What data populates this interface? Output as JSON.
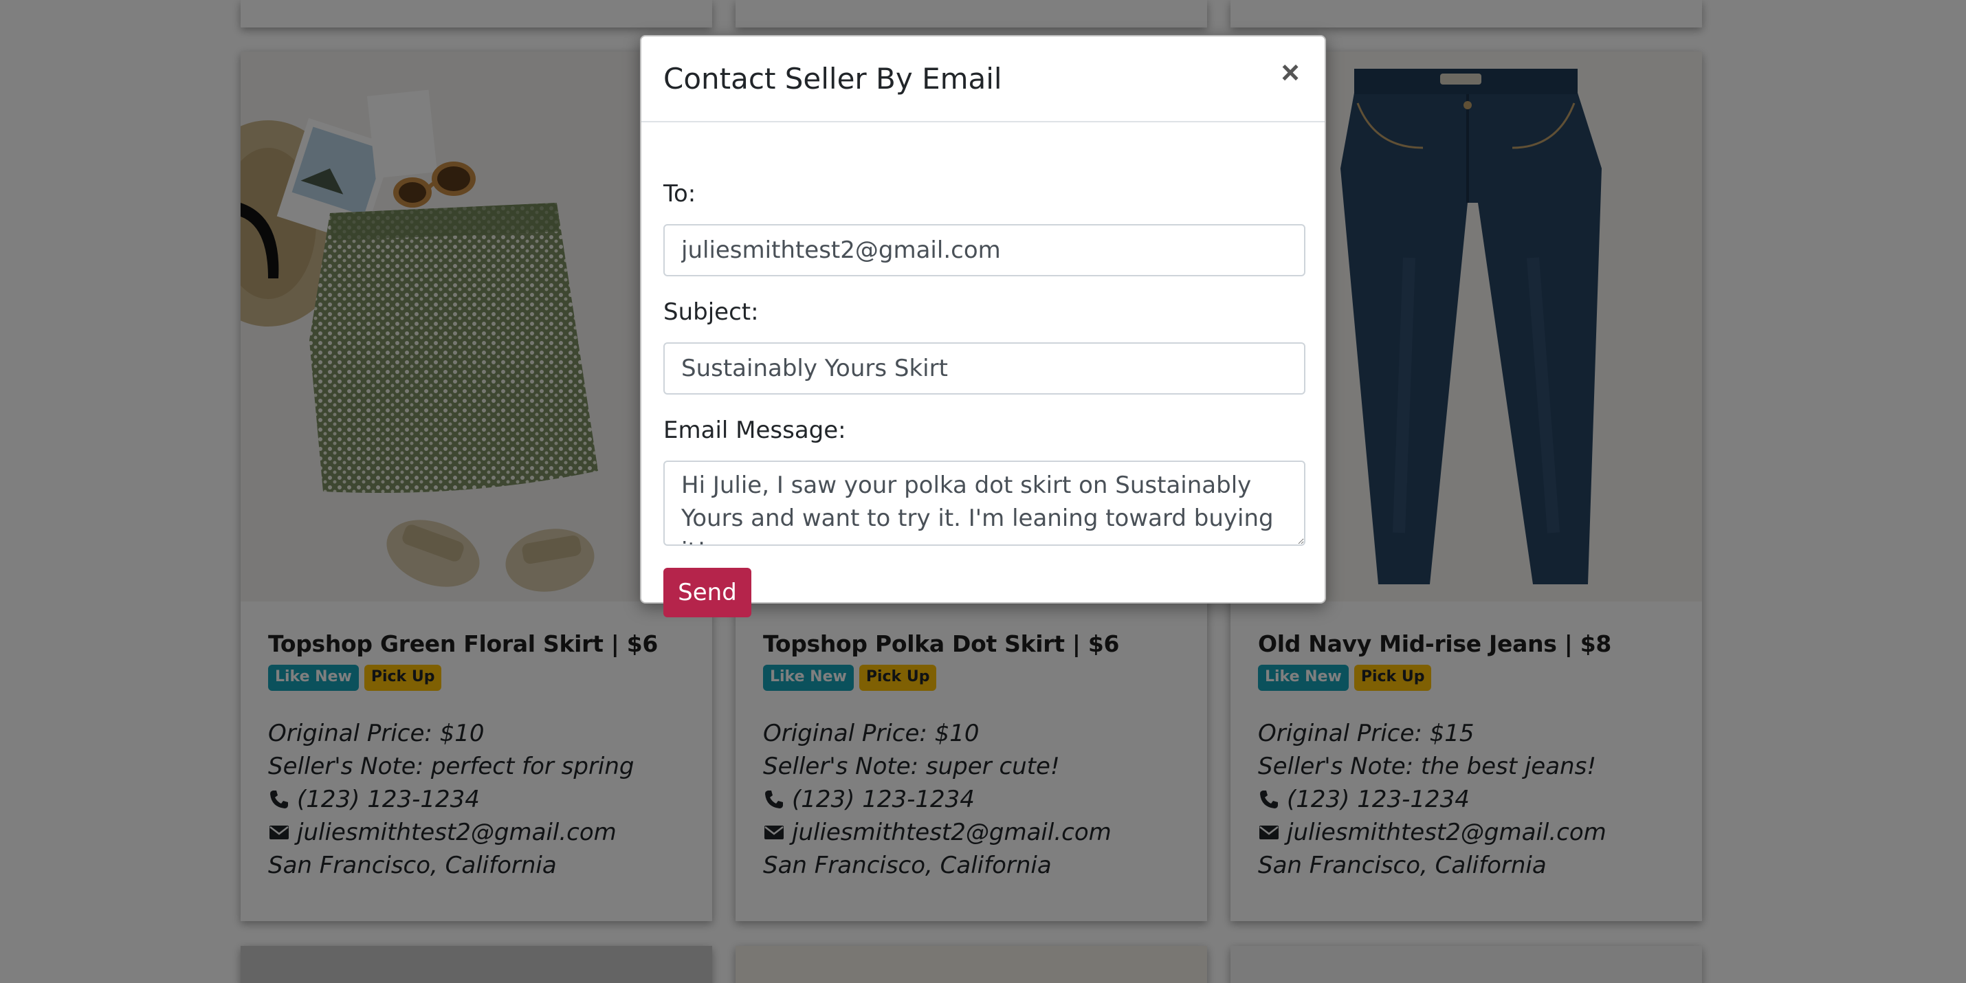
{
  "modal": {
    "title": "Contact Seller By Email",
    "close_label": "×",
    "to_label": "To:",
    "to_value": "juliesmithtest2@gmail.com",
    "subject_label": "Subject:",
    "subject_value": "Sustainably Yours Skirt",
    "message_label": "Email Message:",
    "message_value": "Hi Julie, I saw your polka dot skirt on Sustainably Yours and want to try it. I'm leaning toward buying it!",
    "send_label": "Send"
  },
  "listings": [
    {
      "title": "Topshop Green Floral Skirt | $6",
      "condition": "Like New",
      "shipping": "Pick Up",
      "original_price": "Original Price: $10",
      "note": "Seller's Note: perfect for spring",
      "phone": "(123) 123-1234",
      "email": "juliesmithtest2@gmail.com",
      "location": "San Francisco, California"
    },
    {
      "title": "Topshop Polka Dot Skirt | $6",
      "condition": "Like New",
      "shipping": "Pick Up",
      "original_price": "Original Price: $10",
      "note": "Seller's Note: super cute!",
      "phone": "(123) 123-1234",
      "email": "juliesmithtest2@gmail.com",
      "location": "San Francisco, California"
    },
    {
      "title": "Old Navy Mid-rise Jeans | $8",
      "condition": "Like New",
      "shipping": "Pick Up",
      "original_price": "Original Price: $15",
      "note": "Seller's Note: the best jeans!",
      "phone": "(123) 123-1234",
      "email": "juliesmithtest2@gmail.com",
      "location": "San Francisco, California"
    }
  ],
  "colors": {
    "send_button": "#b5244b",
    "badge_condition": "#17a2b8",
    "badge_shipping": "#ffc107",
    "overlay": "#000000"
  },
  "icons": {
    "phone": "phone-icon",
    "email": "envelope-icon",
    "close": "close-icon"
  }
}
